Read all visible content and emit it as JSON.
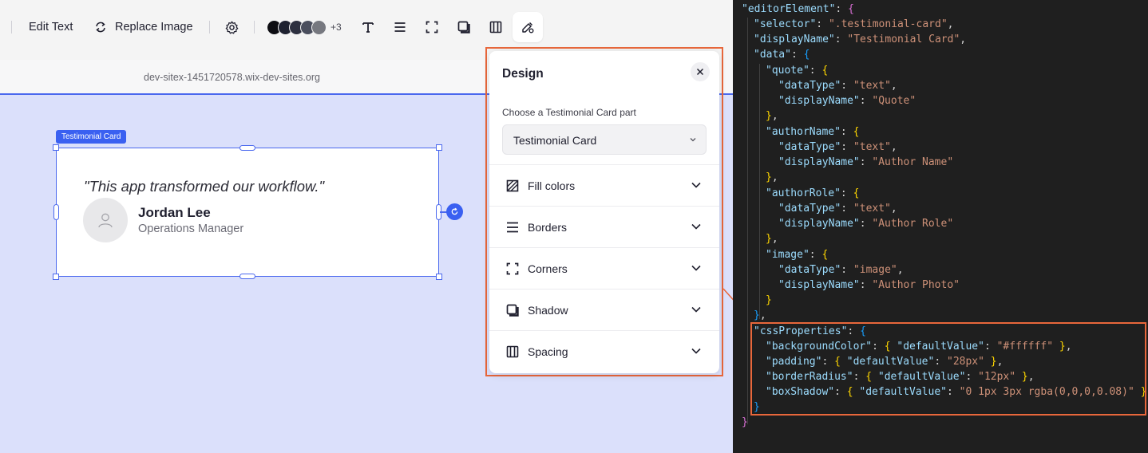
{
  "toolbar": {
    "edit_text": "Edit Text",
    "replace_image": "Replace Image",
    "swatch_colors": [
      "#0d0d12",
      "#1e2130",
      "#2d3040",
      "#4a4e5d",
      "#76787f"
    ],
    "swatch_more": "+3"
  },
  "url": "dev-sitex-1451720578.wix-dev-sites.org",
  "canvas": {
    "badge": "Testimonial Card",
    "quote": "\"This app transformed our workflow.\"",
    "author_name": "Jordan Lee",
    "author_role": "Operations Manager"
  },
  "design_panel": {
    "title": "Design",
    "choose_label": "Choose a Testimonial Card part",
    "selected_part": "Testimonial Card",
    "sections": [
      {
        "label": "Fill colors",
        "icon": "fill-colors-icon"
      },
      {
        "label": "Borders",
        "icon": "borders-icon"
      },
      {
        "label": "Corners",
        "icon": "corners-icon"
      },
      {
        "label": "Shadow",
        "icon": "shadow-icon"
      },
      {
        "label": "Spacing",
        "icon": "spacing-icon"
      }
    ]
  },
  "code": {
    "editor_element": "\"editorElement\"",
    "selector_key": "\"selector\"",
    "selector_val": "\".testimonial-card\"",
    "display_name_key": "\"displayName\"",
    "display_name_val": "\"Testimonial Card\"",
    "data_key": "\"data\"",
    "data_type_key": "\"dataType\"",
    "quote_key": "\"quote\"",
    "quote_type": "\"text\"",
    "quote_name": "\"Quote\"",
    "author_name_key": "\"authorName\"",
    "author_name_type": "\"text\"",
    "author_name_name": "\"Author Name\"",
    "author_role_key": "\"authorRole\"",
    "author_role_type": "\"text\"",
    "author_role_name": "\"Author Role\"",
    "image_key": "\"image\"",
    "image_type": "\"image\"",
    "image_name": "\"Author Photo\"",
    "css_props_key": "\"cssProperties\"",
    "default_value_key": "\"defaultValue\"",
    "bg_key": "\"backgroundColor\"",
    "bg_val": "\"#ffffff\"",
    "padding_key": "\"padding\"",
    "padding_val": "\"28px\"",
    "radius_key": "\"borderRadius\"",
    "radius_val": "\"12px\"",
    "shadow_key": "\"boxShadow\"",
    "shadow_val": "\"0 1px 3px rgba(0,0,0,0.08)\""
  },
  "colors": {
    "accent": "#3a60f1",
    "highlight": "#e8673b"
  }
}
